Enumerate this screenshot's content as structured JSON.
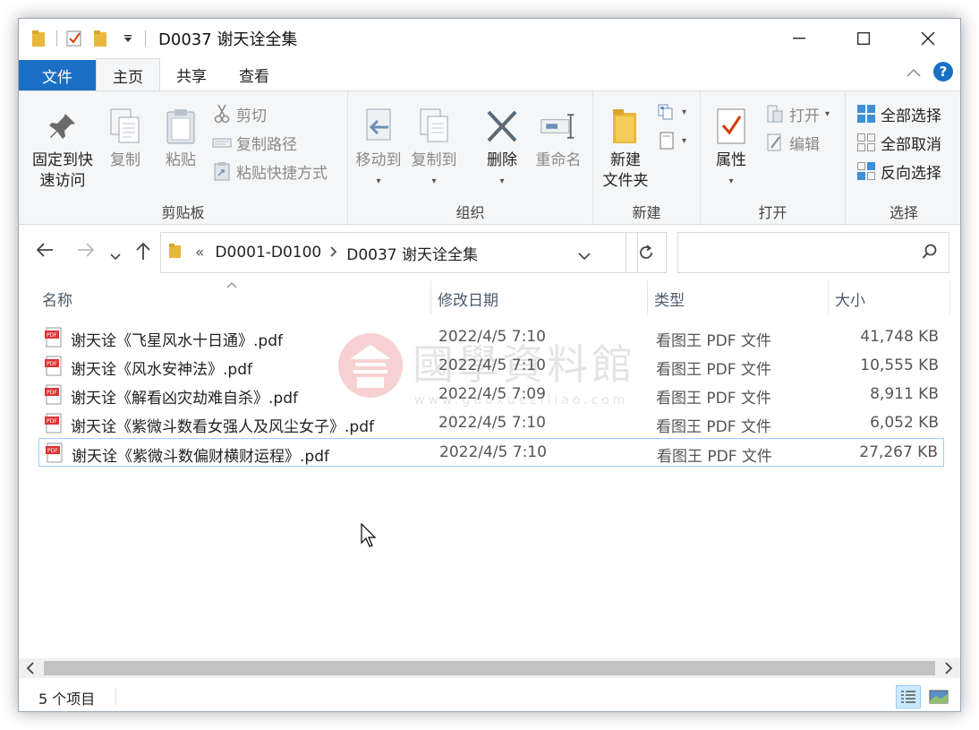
{
  "window": {
    "title": "D0037 谢天诠全集"
  },
  "title_controls": {
    "minimize": "—",
    "maximize": "☐",
    "close": "✕"
  },
  "tabs": {
    "file": "文件",
    "home": "主页",
    "share": "共享",
    "view": "查看"
  },
  "ribbon": {
    "clipboard": {
      "label": "剪贴板",
      "pin_quick_access": "固定到快\n速访问",
      "pin_line1": "固定到快",
      "pin_line2": "速访问",
      "copy": "复制",
      "paste": "粘贴",
      "cut": "剪切",
      "copy_path": "复制路径",
      "paste_shortcut": "粘贴快捷方式"
    },
    "organize": {
      "label": "组织",
      "move_to": "移动到",
      "copy_to": "复制到",
      "delete": "删除",
      "rename": "重命名"
    },
    "new": {
      "label": "新建",
      "new_folder_line1": "新建",
      "new_folder_line2": "文件夹"
    },
    "open": {
      "label": "打开",
      "properties": "属性",
      "open": "打开",
      "edit": "编辑"
    },
    "select": {
      "label": "选择",
      "select_all": "全部选择",
      "select_none": "全部取消",
      "invert": "反向选择"
    }
  },
  "address": {
    "overflow": "«",
    "crumbs": [
      "D0001-D0100",
      "D0037 谢天诠全集"
    ],
    "search_placeholder": ""
  },
  "columns": {
    "name": "名称",
    "date": "修改日期",
    "type": "类型",
    "size": "大小"
  },
  "files": [
    {
      "name": "谢天诠《飞星风水十日通》.pdf",
      "date": "2022/4/5 7:10",
      "type": "看图王 PDF 文件",
      "size": "41,748 KB"
    },
    {
      "name": "谢天诠《风水安神法》.pdf",
      "date": "2022/4/5 7:10",
      "type": "看图王 PDF 文件",
      "size": "10,555 KB"
    },
    {
      "name": "谢天诠《解看凶灾劫难自杀》.pdf",
      "date": "2022/4/5 7:09",
      "type": "看图王 PDF 文件",
      "size": "8,911 KB"
    },
    {
      "name": "谢天诠《紫微斗数看女强人及风尘女子》.pdf",
      "date": "2022/4/5 7:10",
      "type": "看图王 PDF 文件",
      "size": "6,052 KB"
    },
    {
      "name": "谢天诠《紫微斗数偏财横财运程》.pdf",
      "date": "2022/4/5 7:10",
      "type": "看图王 PDF 文件",
      "size": "27,267 KB"
    }
  ],
  "selected_index": 4,
  "watermark": {
    "text": "國學資料館",
    "url": "www.guoxueziliao.com"
  },
  "status": {
    "item_count": "5 个项目"
  },
  "colors": {
    "accent": "#1a6fc4",
    "selection_border": "#99d1ff",
    "ribbon_bg": "#f5f6f7"
  }
}
